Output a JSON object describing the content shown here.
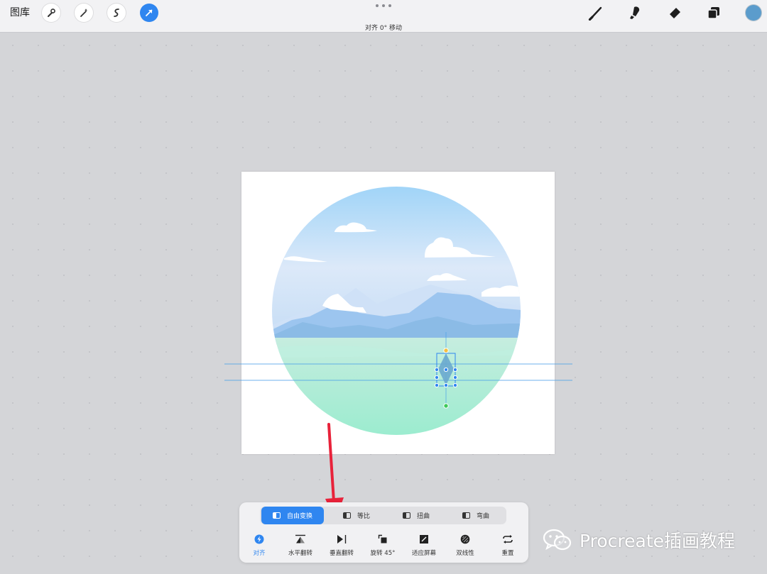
{
  "topbar": {
    "gallery_label": "图库",
    "left_tools": [
      "wrench-icon",
      "magic-wand-icon",
      "selection-icon",
      "transform-arrow-icon"
    ],
    "active_tool": "transform-arrow-icon",
    "status_text": "对齐 0° 移动",
    "right_tools": [
      "brush-icon",
      "smudge-icon",
      "eraser-icon",
      "layers-icon"
    ],
    "current_color": "#5b9ccc"
  },
  "transform_panel": {
    "modes": [
      {
        "label": "自由变换",
        "active": true
      },
      {
        "label": "等比",
        "active": false
      },
      {
        "label": "扭曲",
        "active": false
      },
      {
        "label": "弯曲",
        "active": false
      }
    ],
    "actions": [
      {
        "label": "对齐",
        "icon": "snap-icon"
      },
      {
        "label": "水平翻转",
        "icon": "flip-horizontal-icon"
      },
      {
        "label": "垂直翻转",
        "icon": "flip-vertical-icon"
      },
      {
        "label": "旋转 45°",
        "icon": "rotate-icon"
      },
      {
        "label": "适应屏幕",
        "icon": "fit-screen-icon"
      },
      {
        "label": "双线性",
        "icon": "interpolation-icon"
      },
      {
        "label": "重置",
        "icon": "reset-icon"
      }
    ]
  },
  "colors": {
    "accent": "#2f86f0",
    "arrow": "#e8223a",
    "sky": "#9fd2f5",
    "ground": "#a4ebd3"
  },
  "watermark": {
    "text": "Procreate插画教程",
    "icon": "wechat-icon"
  }
}
